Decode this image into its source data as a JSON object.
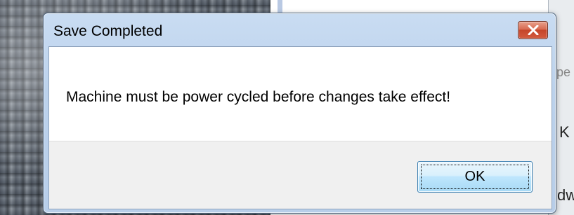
{
  "dialog": {
    "title": "Save Completed",
    "message": "Machine must be power cycled before changes take effect!",
    "ok_label": "OK",
    "close_icon": "close-icon"
  },
  "background_window": {
    "partial_texts": [
      "pe",
      "K",
      "dw"
    ]
  },
  "colors": {
    "titlebar": "#bcd2ec",
    "close_button": "#c5452a",
    "ok_button": "#bee6fd",
    "footer": "#f0f0f0"
  }
}
